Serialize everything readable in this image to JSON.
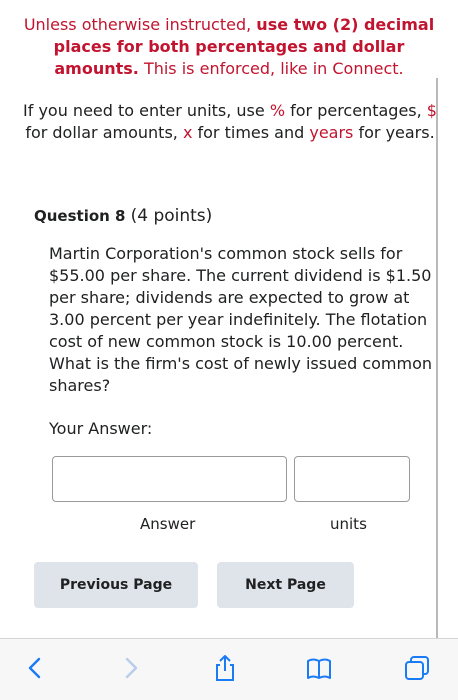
{
  "instructions": {
    "prefix": "Unless otherwise instructed, ",
    "emphasis": "use two (2) decimal places for both percentages and dollar amounts.",
    "suffix": " This is enforced, like in Connect."
  },
  "units_help": {
    "t1": "If you need to enter units, use ",
    "pct": "%",
    "t2": " for percentages, ",
    "dollar": "$",
    "t3": " for dollar amounts, ",
    "times": "x",
    "t4": " for times and ",
    "years": "years",
    "t5": " for years."
  },
  "question": {
    "label": "Question 8",
    "points": "(4 points)",
    "text": "Martin Corporation's common stock sells for $55.00 per share. The current dividend is $1.50  per share; dividends are expected to grow at 3.00 percent per year indefinitely. The flotation cost of new common stock is 10.00 percent. What is the firm's cost of newly issued common shares?"
  },
  "answer": {
    "prompt": "Your Answer:",
    "answer_value": "",
    "units_value": "",
    "answer_label": "Answer",
    "units_label": "units"
  },
  "nav": {
    "previous": "Previous Page",
    "next": "Next Page"
  },
  "toolbar": {
    "icons": [
      "back-icon",
      "forward-icon",
      "share-icon",
      "bookmarks-icon",
      "tabs-icon"
    ],
    "accent": "#1a7cf5",
    "disabled": "#b8cdec"
  },
  "colors": {
    "instruction_red": "#c2142f",
    "button_bg": "#dfe3ea"
  }
}
